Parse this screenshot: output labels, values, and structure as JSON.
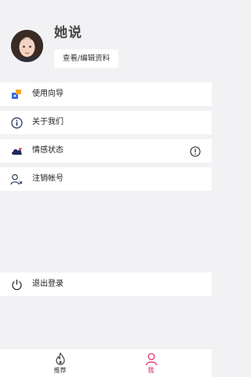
{
  "profile": {
    "username": "她说",
    "edit_button": "查看/编辑资料"
  },
  "menu": {
    "guide": "使用向导",
    "about": "关于我们",
    "emotion_status": "情感状态",
    "cancel_account": "注销帐号",
    "logout": "退出登录"
  },
  "tabbar": {
    "recommend": "推荐",
    "me": "我"
  },
  "colors": {
    "accent": "#e0245e",
    "icon_dark": "#1f2a5a",
    "background": "#f2f2f4"
  }
}
